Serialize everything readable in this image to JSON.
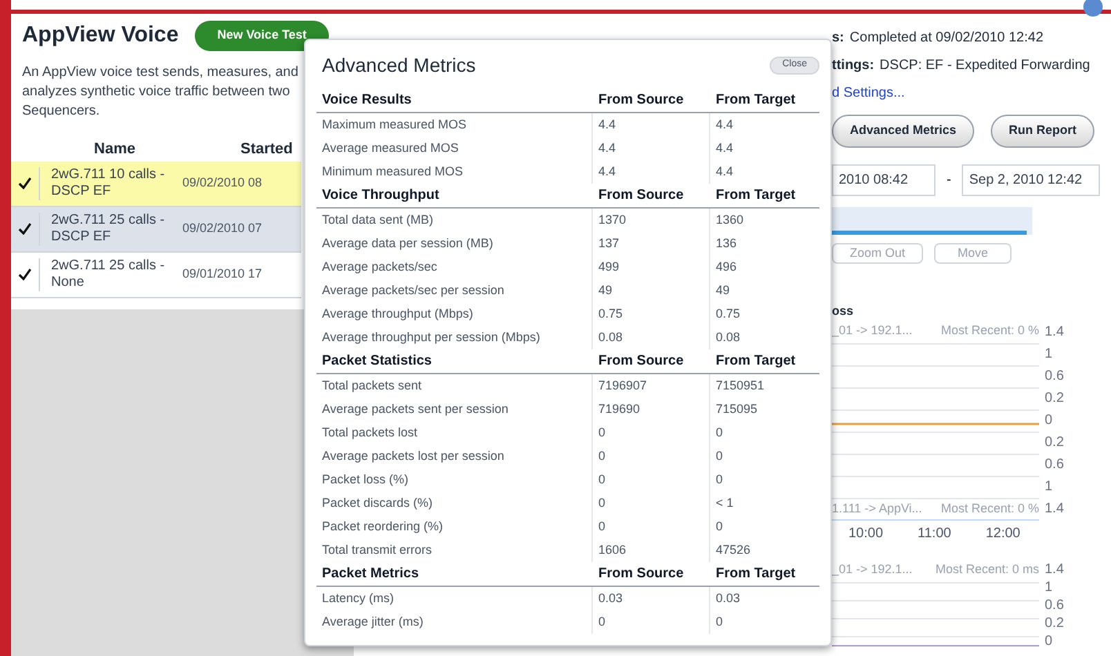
{
  "panel": {
    "title": "AppView Voice",
    "new_button": "New Voice Test",
    "description": "An AppView voice test sends, measures, and analyzes synthetic voice traffic between two Sequencers.",
    "columns": [
      "Name",
      "Started"
    ],
    "rows": [
      {
        "name": "2wG.711 10 calls - DSCP EF",
        "started": "09/02/2010 08",
        "checked": true,
        "selected": true
      },
      {
        "name": "2wG.711 25 calls - DSCP EF",
        "started": "09/02/2010 07",
        "checked": true,
        "selected": false
      },
      {
        "name": "2wG.711 25 calls - None",
        "started": "09/01/2010 17",
        "checked": true,
        "selected": false
      }
    ]
  },
  "details": {
    "status_label": "s:",
    "status_value": "Completed at 09/02/2010 12:42",
    "settings_label": "ttings:",
    "settings_value": "DSCP: EF - Expedited Forwarding",
    "settings_link": "d Settings...",
    "buttons": [
      "Advanced Metrics",
      "Run Report"
    ],
    "date_from": "2010 08:42",
    "date_sep": "-",
    "date_to": "Sep 2, 2010 12:42",
    "zoom_out": "Zoom Out",
    "move": "Move",
    "section": "oss"
  },
  "charts": [
    {
      "legend_top": "_01 -> 192.1...",
      "recent_top": "Most Recent: 0 %",
      "legend_bottom": "1.111 -> AppVi...",
      "recent_bottom": "Most Recent: 0 %",
      "ticks": [
        "1.4",
        "1",
        "0.6",
        "0.2",
        "0",
        "0.2",
        "0.6",
        "1",
        "1.4"
      ],
      "xticks": [
        "10:00",
        "11:00",
        "12:00"
      ]
    },
    {
      "legend_top": "_01 -> 192.1...",
      "recent_top": "Most Recent: 0 ms",
      "ticks": [
        "1.4",
        "1",
        "0.6",
        "0.2",
        "0"
      ]
    }
  ],
  "timeline": {
    "level": 0.97
  },
  "modal": {
    "title": "Advanced Metrics",
    "close": "Close",
    "sections": [
      {
        "title": "Voice Results",
        "col1": "From Source",
        "col2": "From Target",
        "rows": [
          [
            "Maximum measured MOS",
            "4.4",
            "4.4"
          ],
          [
            "Average measured MOS",
            "4.4",
            "4.4"
          ],
          [
            "Minimum measured MOS",
            "4.4",
            "4.4"
          ]
        ]
      },
      {
        "title": "Voice Throughput",
        "col1": "From Source",
        "col2": "From Target",
        "rows": [
          [
            "Total data sent (MB)",
            "1370",
            "1360"
          ],
          [
            "Average data per session (MB)",
            "137",
            "136"
          ],
          [
            "Average packets/sec",
            "499",
            "496"
          ],
          [
            "Average packets/sec per session",
            "49",
            "49"
          ],
          [
            "Average throughput (Mbps)",
            "0.75",
            "0.75"
          ],
          [
            "Average throughput per session (Mbps)",
            "0.08",
            "0.08"
          ]
        ]
      },
      {
        "title": "Packet Statistics",
        "col1": "From Source",
        "col2": "From Target",
        "rows": [
          [
            "Total packets sent",
            "7196907",
            "7150951"
          ],
          [
            "Average packets sent per session",
            "719690",
            "715095"
          ],
          [
            "Total packets lost",
            "0",
            "0"
          ],
          [
            "Average packets lost per session",
            "0",
            "0"
          ],
          [
            "Packet loss (%)",
            "0",
            "0"
          ],
          [
            "Packet discards (%)",
            "0",
            "< 1"
          ],
          [
            "Packet reordering (%)",
            "0",
            "0"
          ],
          [
            "Total transmit errors",
            "1606",
            "47526"
          ]
        ]
      },
      {
        "title": "Packet Metrics",
        "col1": "From Source",
        "col2": "From Target",
        "rows": [
          [
            "Latency (ms)",
            "0.03",
            "0.03"
          ],
          [
            "Average jitter (ms)",
            "0",
            "0"
          ]
        ]
      }
    ]
  }
}
